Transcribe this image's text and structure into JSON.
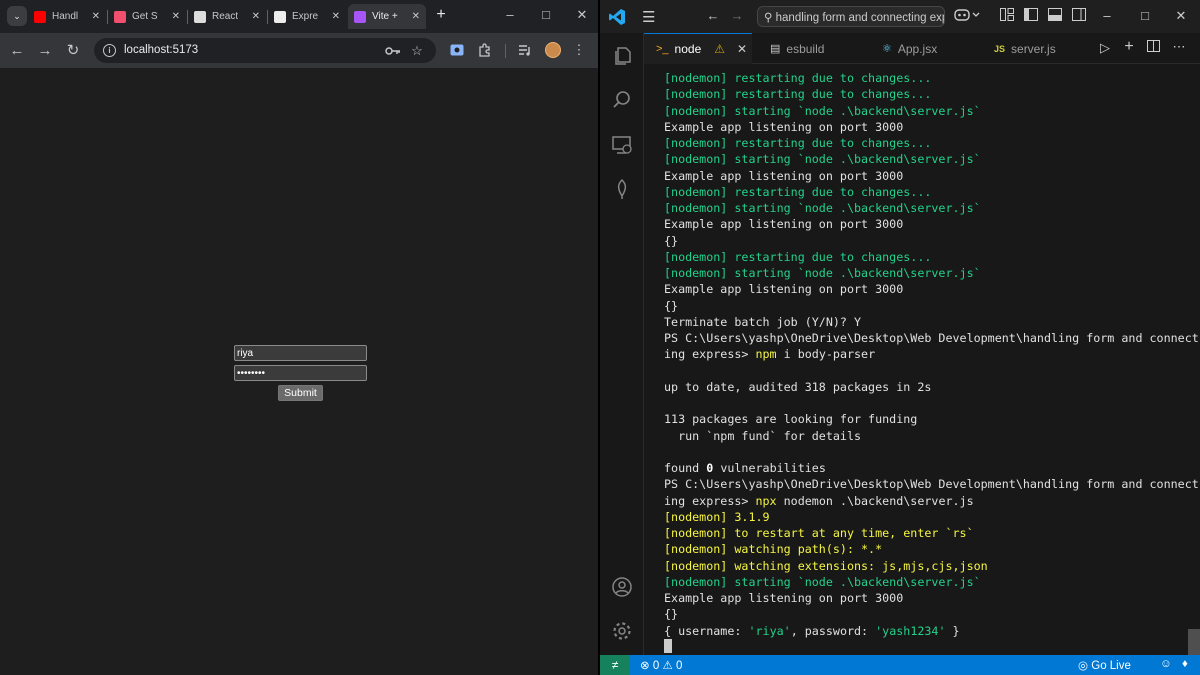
{
  "browser": {
    "tabs": [
      {
        "label": "Handli",
        "favicon": "youtube-icon",
        "color": "#ff0000"
      },
      {
        "label": "Get St",
        "favicon": "page-icon",
        "color": "#f0506e"
      },
      {
        "label": "React",
        "favicon": "react-icon",
        "color": "#dddddd"
      },
      {
        "label": "Expre",
        "favicon": "express-icon",
        "color": "#eeeeee"
      },
      {
        "label": "Vite +",
        "favicon": "vite-icon",
        "color": "#a855f7",
        "active": true
      }
    ],
    "address": "localhost:5173"
  },
  "form": {
    "username_value": "riya",
    "password_value": "yash1234",
    "submit_label": "Submit"
  },
  "vscode": {
    "command_center": "handling form and connecting expre",
    "tabs": [
      {
        "label": "node",
        "icon": "terminal-icon",
        "active": true
      },
      {
        "label": "esbuild",
        "icon": "terminal-icon"
      },
      {
        "label": "App.jsx",
        "icon": "react-icon"
      },
      {
        "label": "server.js",
        "icon": "js-icon"
      }
    ],
    "terminal_lines": [
      [
        {
          "t": "[nodemon] restarting due to changes...",
          "c": "g"
        }
      ],
      [
        {
          "t": "[nodemon] restarting due to changes...",
          "c": "g"
        }
      ],
      [
        {
          "t": "[nodemon] starting `node .\\backend\\server.js`",
          "c": "g"
        }
      ],
      [
        {
          "t": "Example app listening on port 3000",
          "c": "w"
        }
      ],
      [
        {
          "t": "[nodemon] restarting due to changes...",
          "c": "g"
        }
      ],
      [
        {
          "t": "[nodemon] starting `node .\\backend\\server.js`",
          "c": "g"
        }
      ],
      [
        {
          "t": "Example app listening on port 3000",
          "c": "w"
        }
      ],
      [
        {
          "t": "[nodemon] restarting due to changes...",
          "c": "g"
        }
      ],
      [
        {
          "t": "[nodemon] starting `node .\\backend\\server.js`",
          "c": "g"
        }
      ],
      [
        {
          "t": "Example app listening on port 3000",
          "c": "w"
        }
      ],
      [
        {
          "t": "{}",
          "c": "w"
        }
      ],
      [
        {
          "t": "[nodemon] restarting due to changes...",
          "c": "g"
        }
      ],
      [
        {
          "t": "[nodemon] starting `node .\\backend\\server.js`",
          "c": "g"
        }
      ],
      [
        {
          "t": "Example app listening on port 3000",
          "c": "w"
        }
      ],
      [
        {
          "t": "{}",
          "c": "w"
        }
      ],
      [
        {
          "t": "Terminate batch job (Y/N)? Y",
          "c": "w"
        }
      ],
      [
        {
          "t": "PS C:\\Users\\yashp\\OneDrive\\Desktop\\Web Development\\handling form and connect",
          "c": "w"
        }
      ],
      [
        {
          "t": "ing express> ",
          "c": "w"
        },
        {
          "t": "npm",
          "c": "cmdc"
        },
        {
          "t": " i body-parser",
          "c": "w"
        }
      ],
      [
        {
          "t": "",
          "c": "w"
        }
      ],
      [
        {
          "t": "up to date, audited 318 packages in 2s",
          "c": "w"
        }
      ],
      [
        {
          "t": "",
          "c": "w"
        }
      ],
      [
        {
          "t": "113 packages are looking for funding",
          "c": "w"
        }
      ],
      [
        {
          "t": "  run `npm fund` for details",
          "c": "w"
        }
      ],
      [
        {
          "t": "",
          "c": "w"
        }
      ],
      [
        {
          "t": "found ",
          "c": "w"
        },
        {
          "t": "0",
          "c": "bold"
        },
        {
          "t": " vulnerabilities",
          "c": "w"
        }
      ],
      [
        {
          "t": "PS C:\\Users\\yashp\\OneDrive\\Desktop\\Web Development\\handling form and connect",
          "c": "w"
        }
      ],
      [
        {
          "t": "ing express> ",
          "c": "w"
        },
        {
          "t": "npx",
          "c": "cmdc"
        },
        {
          "t": " nodemon .\\backend\\server.js",
          "c": "w"
        }
      ],
      [
        {
          "t": "[nodemon] 3.1.9",
          "c": "y"
        }
      ],
      [
        {
          "t": "[nodemon] to restart at any time, enter `rs`",
          "c": "y"
        }
      ],
      [
        {
          "t": "[nodemon] watching path(s): *.*",
          "c": "y"
        }
      ],
      [
        {
          "t": "[nodemon] watching extensions: js,mjs,cjs,json",
          "c": "y"
        }
      ],
      [
        {
          "t": "[nodemon] starting `node .\\backend\\server.js`",
          "c": "g"
        }
      ],
      [
        {
          "t": "Example app listening on port 3000",
          "c": "w"
        }
      ],
      [
        {
          "t": "{}",
          "c": "w"
        }
      ],
      [
        {
          "t": "{ username: ",
          "c": "w"
        },
        {
          "t": "'riya'",
          "c": "str"
        },
        {
          "t": ", password: ",
          "c": "w"
        },
        {
          "t": "'yash1234'",
          "c": "str"
        },
        {
          "t": " }",
          "c": "w"
        }
      ]
    ]
  },
  "status": {
    "errors": "0",
    "warnings": "0",
    "go_live": "Go Live"
  }
}
